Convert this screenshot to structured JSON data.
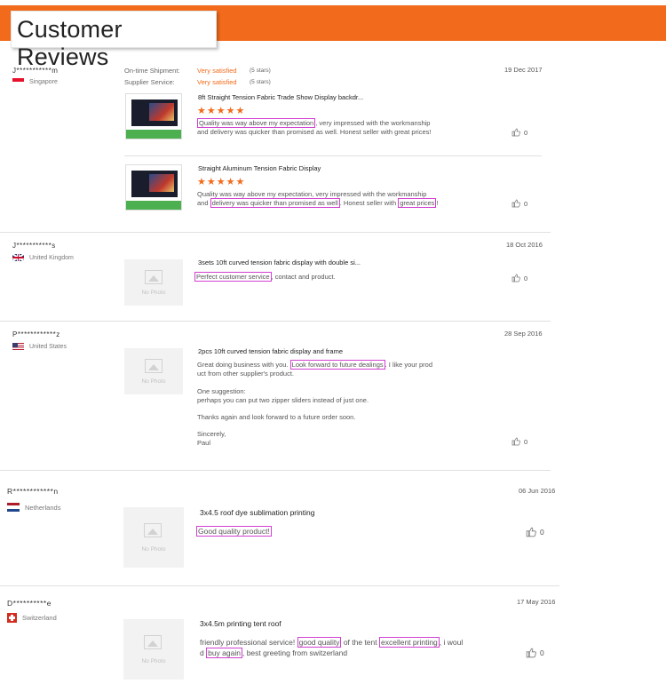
{
  "header": {
    "title": "Customer Reviews"
  },
  "reviews": [
    {
      "user": "J***********m",
      "country": "Singapore",
      "date": "19 Dec 2017",
      "shipment_label": "On-time Shipment:",
      "shipment_value": "Very satisfied",
      "shipment_stars": "(5 stars)",
      "supplier_label": "Supplier Service:",
      "supplier_value": "Very satisfied",
      "supplier_stars": "(5 stars)",
      "items": [
        {
          "title": "8ft Straight Tension Fabric Trade Show Display backdr...",
          "stars": "★★★★★",
          "hl1": "Quality was way above my expectation",
          "text1": ", very impressed with the workmanship",
          "line2": "and delivery was quicker than promised as well. Honest seller with great prices!",
          "likes": "0"
        },
        {
          "title": "Straight Aluminum Tension Fabric Display",
          "stars": "★★★★★",
          "line1": "Quality was way above my expectation, very impressed with the workmanship",
          "pre2": "and ",
          "hl2": "delivery was quicker than promised as well",
          "mid2": ". Honest seller with ",
          "hl3": "great prices",
          "end2": "!",
          "likes": "0"
        }
      ]
    },
    {
      "user": "J***********s",
      "country": "United Kingdom",
      "date": "18 Oct 2016",
      "no_photo": "No Photo",
      "title": "3sets 10ft curved tension fabric display with double si...",
      "hl1": "Perfect customer service",
      "text1": ", contact and product.",
      "likes": "0"
    },
    {
      "user": "P************z",
      "country": "United States",
      "date": "28 Sep 2016",
      "no_photo": "No Photo",
      "title": "2pcs 10ft curved tension fabric display and frame",
      "pre1": "Great doing business with you. ",
      "hl1": "Look forward to future dealings",
      "post1": ". I like your prod",
      "line2": "uct from other supplier's product.",
      "line3": "One suggestion:",
      "line4": "perhaps you can put two zipper sliders instead of just one.",
      "line5": "Thanks again and look forward to a future order soon.",
      "line6": "Sincerely,",
      "line7": "Paul",
      "likes": "0"
    },
    {
      "user": "R************n",
      "country": "Netherlands",
      "date": "06 Jun 2016",
      "no_photo": "No Photo",
      "title": "3x4.5 roof dye sublimation printing",
      "hl1": "Good quality product!",
      "likes": "0"
    },
    {
      "user": "D**********e",
      "country": "Switzerland",
      "date": "17 May 2016",
      "no_photo": "No Photo",
      "title": "3x4.5m printing tent roof",
      "pre1": "friendly professional service! ",
      "hl1": "good quality",
      "mid1": " of the tent ",
      "hl2": "excellent printing",
      "post1": ", i woul",
      "pre2": "d ",
      "hl3": "buy again",
      "post2": ", best greeting from switzerland",
      "likes": "0"
    }
  ]
}
